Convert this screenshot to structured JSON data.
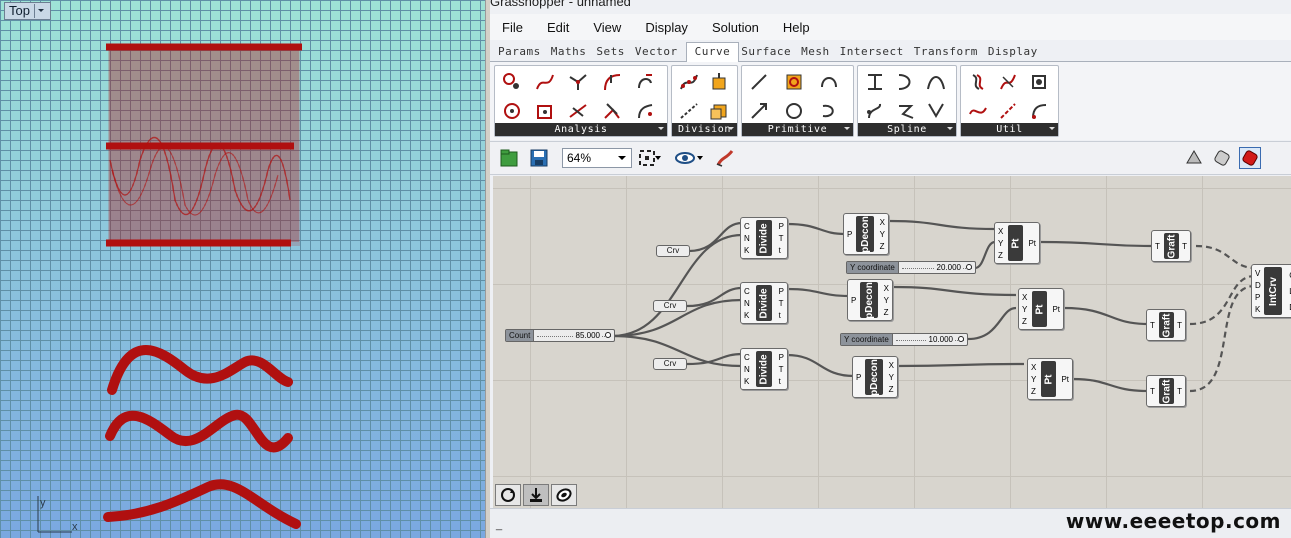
{
  "viewport": {
    "label": "Top",
    "axis_x": "x",
    "axis_y": "y"
  },
  "window": {
    "title": "Grasshopper - unnamed"
  },
  "menu": [
    "File",
    "Edit",
    "View",
    "Display",
    "Solution",
    "Help"
  ],
  "tabs": [
    "Params",
    "Maths",
    "Sets",
    "Vector",
    "Curve",
    "Surface",
    "Mesh",
    "Intersect",
    "Transform",
    "Display"
  ],
  "active_tab": "Curve",
  "ribbon_panels": [
    "Analysis",
    "Division",
    "Primitive",
    "Spline",
    "Util"
  ],
  "toolbar": {
    "zoom": "64%"
  },
  "canvas": {
    "count_slider": {
      "name": "Count",
      "value": "85.000"
    },
    "y_slider_1": {
      "name": "Y coordinate",
      "value": "20.000"
    },
    "y_slider_2": {
      "name": "Y coordinate",
      "value": "10.000"
    },
    "crv_label": "Crv",
    "divide": {
      "title": "Divide",
      "inputs": [
        "C",
        "N",
        "K"
      ],
      "outputs": [
        "P",
        "T",
        "t"
      ]
    },
    "pdecon": {
      "title": "pDecon",
      "inputs": [
        "P"
      ],
      "outputs": [
        "X",
        "Y",
        "Z"
      ]
    },
    "pt": {
      "title": "Pt",
      "inputs": [
        "X",
        "Y",
        "Z"
      ],
      "outputs": [
        "Pt"
      ]
    },
    "graft": {
      "title": "Graft",
      "inputs": [
        "T"
      ],
      "outputs": [
        "T"
      ]
    },
    "intcrv": {
      "title": "IntCrv",
      "inputs": [
        "V",
        "D",
        "P",
        "K"
      ],
      "outputs": [
        "C",
        "L",
        "D"
      ]
    }
  },
  "status": {
    "text": "_",
    "watermark": "www.eeeetop.com"
  },
  "colors": {
    "curve_red": "#b01010",
    "viewport_grid": "#5f8fa6",
    "canvas_bg": "#d8d5ce",
    "component_body": "#3a3a3a"
  }
}
